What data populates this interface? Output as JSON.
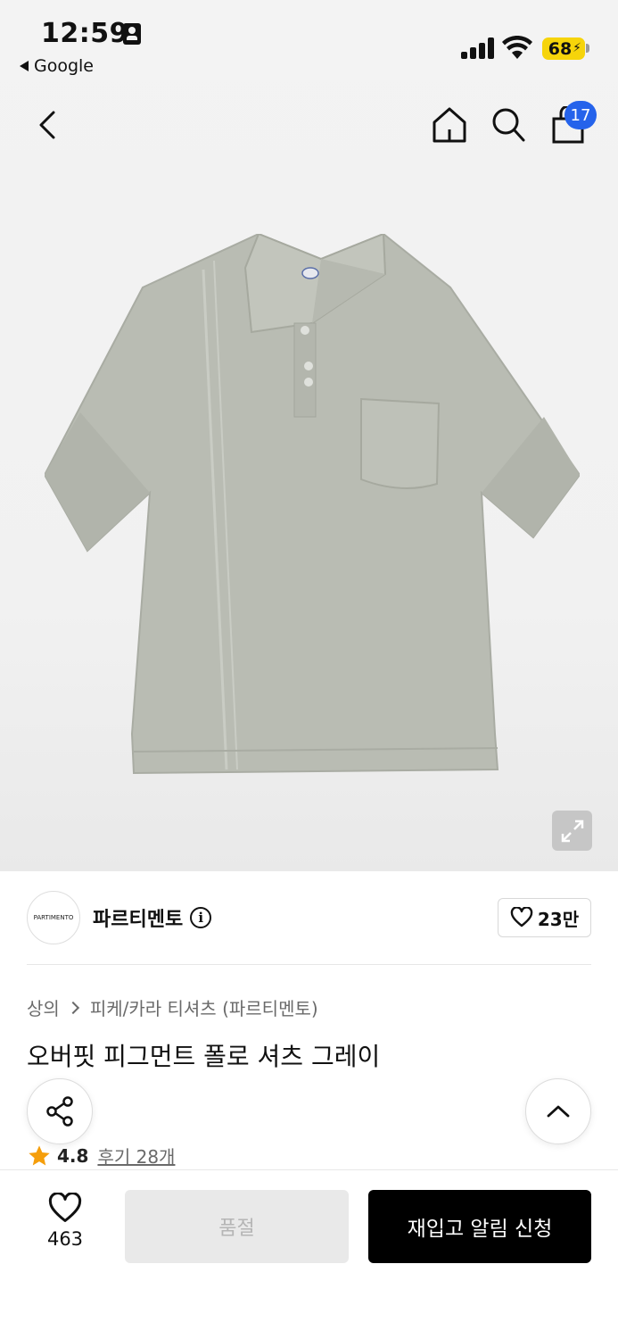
{
  "status_bar": {
    "time": "12:59",
    "back_app": "Google",
    "battery": "68"
  },
  "nav": {
    "cart_badge": "17",
    "icons": [
      "chevron-left-icon",
      "home-icon",
      "search-icon",
      "shopping-bag-icon"
    ]
  },
  "product_image": {
    "colors": {
      "shirt": "#b9bcb3",
      "shirt_shadow": "#a8aba2",
      "background": "#f2f2f2"
    }
  },
  "brand": {
    "logo_text": "PARTIMENTO",
    "name": "파르티멘토",
    "likes": "23만"
  },
  "breadcrumb": {
    "category": "상의",
    "subcategory": "피케/카라 티셔츠 (파르티멘토)"
  },
  "product": {
    "title": "오버핏 피그먼트 폴로 셔츠 그레이",
    "rating": "4.8",
    "reviews": "후기 28개"
  },
  "bottom_bar": {
    "wish_count": "463",
    "soldout_label": "품절",
    "restock_label": "재입고 알림 신청"
  },
  "colors": {
    "accent_badge": "#2563eb",
    "star": "#f59e0b",
    "primary_button": "#000000",
    "disabled_button": "#e9e9e9",
    "battery": "#f6d40a"
  }
}
